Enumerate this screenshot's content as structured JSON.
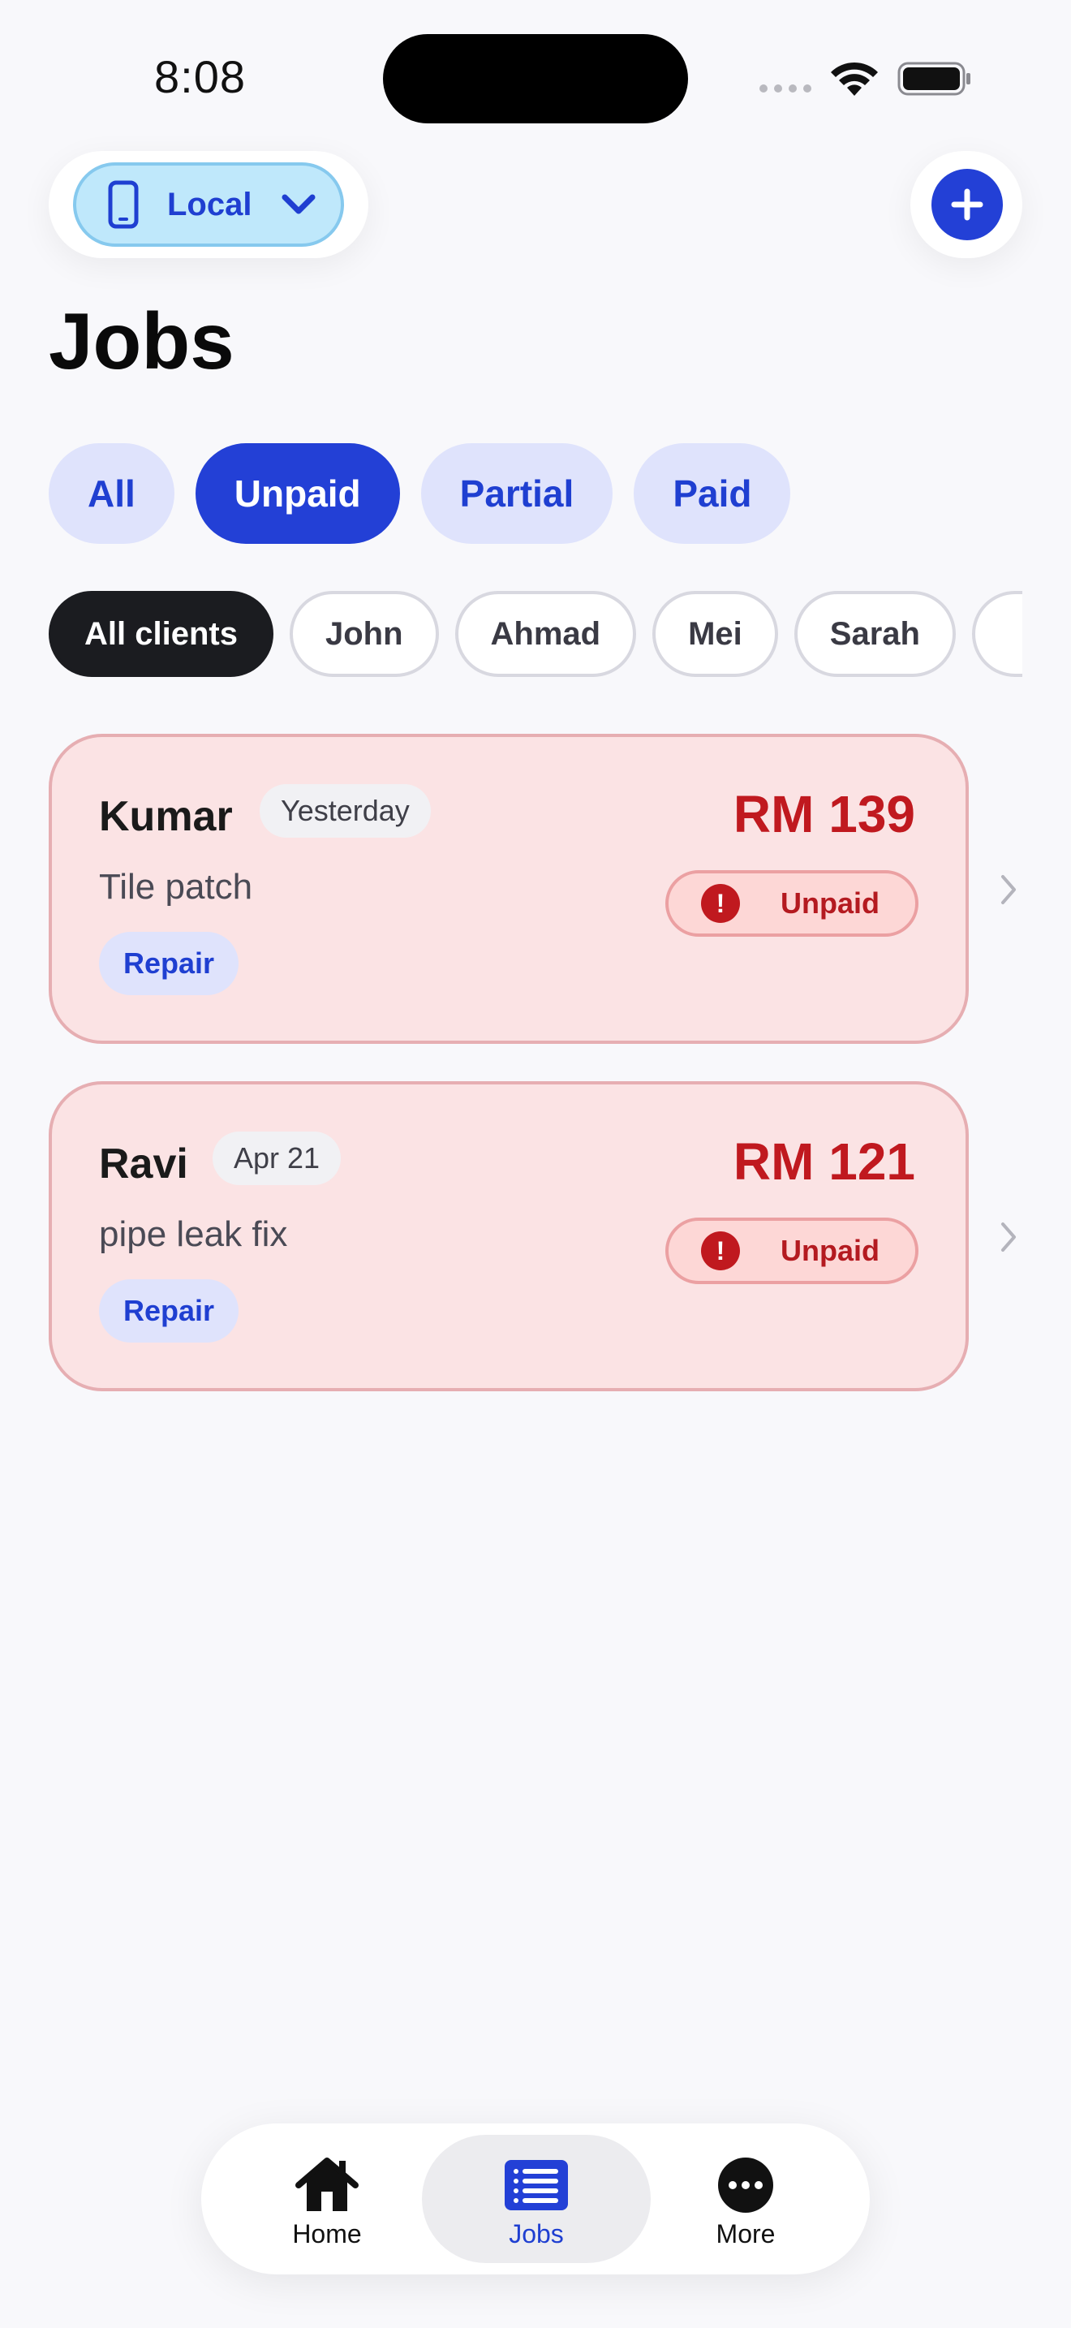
{
  "status_bar": {
    "time": "8:08"
  },
  "header": {
    "mode_selector_label": "Local",
    "add_button_icon": "plus-icon"
  },
  "page_title": "Jobs",
  "status_filters": [
    {
      "label": "All",
      "active": false
    },
    {
      "label": "Unpaid",
      "active": true
    },
    {
      "label": "Partial",
      "active": false
    },
    {
      "label": "Paid",
      "active": false
    }
  ],
  "client_filters": [
    {
      "label": "All clients",
      "active": true
    },
    {
      "label": "John",
      "active": false
    },
    {
      "label": "Ahmad",
      "active": false
    },
    {
      "label": "Mei",
      "active": false
    },
    {
      "label": "Sarah",
      "active": false
    }
  ],
  "jobs": [
    {
      "client": "Kumar",
      "date": "Yesterday",
      "description": "Tile patch",
      "tag": "Repair",
      "amount": "RM 139",
      "payment_status": "Unpaid"
    },
    {
      "client": "Ravi",
      "date": "Apr 21",
      "description": "pipe leak fix",
      "tag": "Repair",
      "amount": "RM 121",
      "payment_status": "Unpaid"
    }
  ],
  "tabbar": {
    "tabs": [
      {
        "label": "Home",
        "icon": "house-icon",
        "active": false
      },
      {
        "label": "Jobs",
        "icon": "list-icon",
        "active": true
      },
      {
        "label": "More",
        "icon": "ellipsis-icon",
        "active": false
      }
    ]
  },
  "colors": {
    "accent": "#2340d6",
    "unpaid_red": "#c0191f",
    "card_bg": "#fbe3e4"
  }
}
